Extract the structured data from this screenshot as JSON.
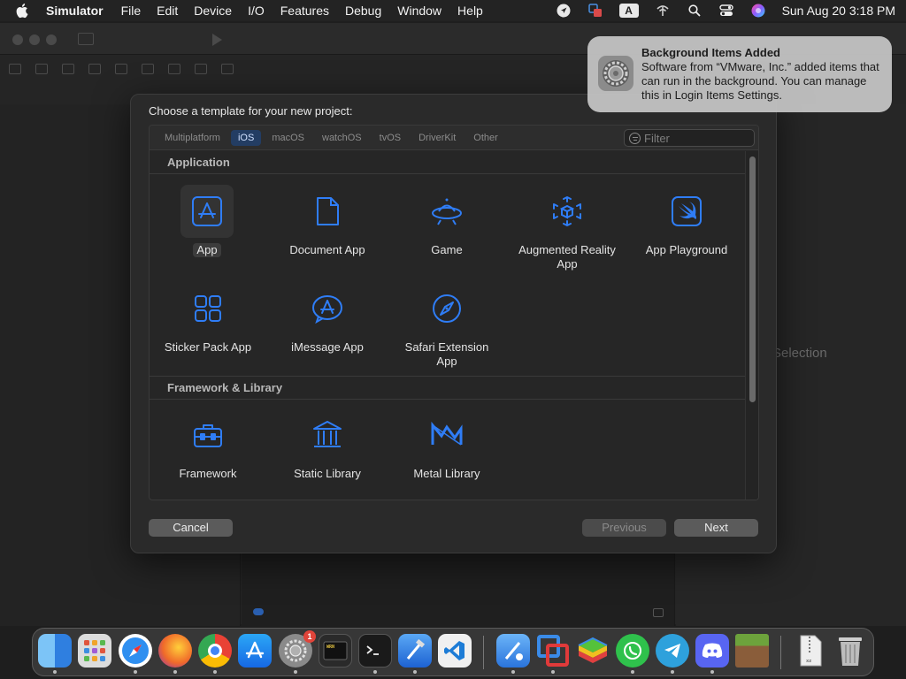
{
  "menubar": {
    "app_name": "Simulator",
    "items": [
      "File",
      "Edit",
      "Device",
      "I/O",
      "Features",
      "Debug",
      "Window",
      "Help"
    ],
    "input_source": "A",
    "clock": "Sun Aug 20  3:18 PM"
  },
  "background_window": {
    "inspector_placeholder": "Selection"
  },
  "sheet": {
    "title": "Choose a template for your new project:",
    "tabs": [
      {
        "label": "Multiplatform",
        "active": false
      },
      {
        "label": "iOS",
        "active": true
      },
      {
        "label": "macOS",
        "active": false
      },
      {
        "label": "watchOS",
        "active": false
      },
      {
        "label": "tvOS",
        "active": false
      },
      {
        "label": "DriverKit",
        "active": false
      },
      {
        "label": "Other",
        "active": false
      }
    ],
    "filter_placeholder": "Filter",
    "sections": [
      {
        "title": "Application",
        "templates": [
          {
            "label": "App",
            "icon": "app-store-icon",
            "selected": true
          },
          {
            "label": "Document App",
            "icon": "document-icon",
            "selected": false
          },
          {
            "label": "Game",
            "icon": "game-ufo-icon",
            "selected": false
          },
          {
            "label": "Augmented Reality App",
            "icon": "ar-cube-icon",
            "selected": false
          },
          {
            "label": "App Playground",
            "icon": "swift-icon",
            "selected": false
          },
          {
            "label": "Sticker Pack App",
            "icon": "sticker-grid-icon",
            "selected": false
          },
          {
            "label": "iMessage App",
            "icon": "imessage-icon",
            "selected": false
          },
          {
            "label": "Safari Extension App",
            "icon": "compass-icon",
            "selected": false
          }
        ]
      },
      {
        "title": "Framework & Library",
        "templates": [
          {
            "label": "Framework",
            "icon": "toolbox-icon",
            "selected": false
          },
          {
            "label": "Static Library",
            "icon": "library-columns-icon",
            "selected": false
          },
          {
            "label": "Metal Library",
            "icon": "metal-icon",
            "selected": false
          }
        ]
      }
    ],
    "buttons": {
      "cancel": "Cancel",
      "previous": "Previous",
      "next": "Next"
    }
  },
  "notification": {
    "title": "Background Items Added",
    "body": "Software from “VMware, Inc.” added items that can run in the background. You can manage this in Login Items Settings.",
    "icon": "system-settings-gear-icon"
  },
  "dock": {
    "items": [
      {
        "name": "finder-icon",
        "color": "#3b8de0"
      },
      {
        "name": "launchpad-icon",
        "color": "#d9d9d9"
      },
      {
        "name": "safari-icon",
        "color": "#2f8ff0"
      },
      {
        "name": "firefox-icon",
        "color": "#e8642a"
      },
      {
        "name": "chrome-icon",
        "color": "#e9e9e9"
      },
      {
        "name": "app-store-icon",
        "color": "#1c8cf0"
      },
      {
        "name": "system-settings-icon",
        "color": "#8a8a8a",
        "badge": "1"
      },
      {
        "name": "console-icon",
        "color": "#2a2a2a"
      },
      {
        "name": "terminal-icon",
        "color": "#1a1a1a"
      },
      {
        "name": "xcode-icon",
        "color": "#2d7fe0"
      },
      {
        "name": "vscode-icon",
        "color": "#1d7cd6"
      },
      {
        "name": "simulator-icon",
        "color": "#3a8be8"
      },
      {
        "name": "vmware-fusion-icon",
        "color": "#2a6fc0"
      },
      {
        "name": "bluestacks-icon",
        "color": "#4bb84b"
      },
      {
        "name": "whatsapp-icon",
        "color": "#2fc14c"
      },
      {
        "name": "telegram-icon",
        "color": "#2ea1dc"
      },
      {
        "name": "discord-icon",
        "color": "#5865f2"
      },
      {
        "name": "minecraft-icon",
        "color": "#6a8f3a"
      },
      {
        "name": "archive-file-icon",
        "color": "#e8e8e8"
      },
      {
        "name": "trash-icon",
        "color": "#9a9a9a"
      }
    ]
  },
  "colors": {
    "accent": "#2f7df6",
    "tab_active_bg": "#233d63",
    "sheet_bg": "#2a2a2a"
  }
}
